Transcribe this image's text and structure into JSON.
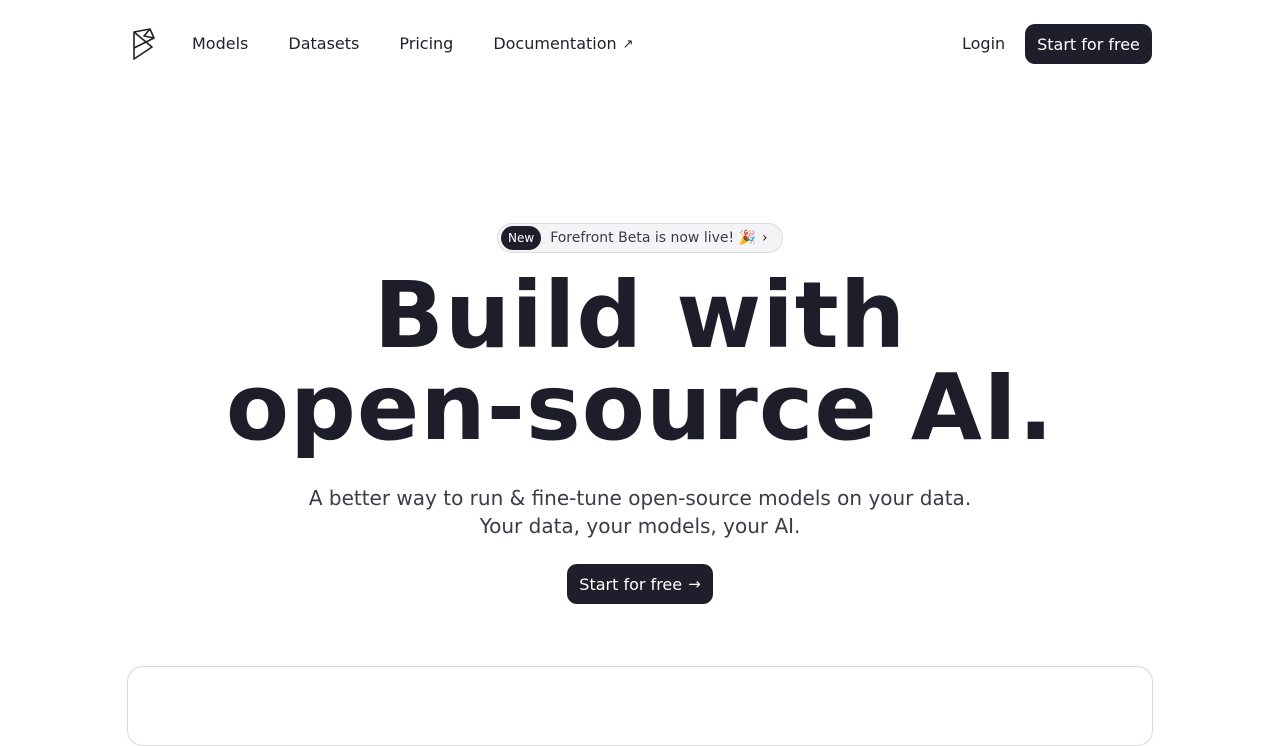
{
  "nav": {
    "logo_icon": "forefront-logo-icon",
    "links": [
      {
        "label": "Models"
      },
      {
        "label": "Datasets"
      },
      {
        "label": "Pricing"
      },
      {
        "label": "Documentation",
        "icon": "external-arrow-icon",
        "icon_glyph": "↗"
      }
    ],
    "login_label": "Login",
    "cta_label": "Start for free"
  },
  "announcement": {
    "badge": "New",
    "text": "Forefront Beta is now live! 🎉",
    "icon": "chevron-right-icon",
    "icon_glyph": "›"
  },
  "hero": {
    "title_line1": "Build with",
    "title_line2": "open-source AI.",
    "subtitle_line1": "A better way to run & fine-tune open-source models on your data.",
    "subtitle_line2": "Your data, your models, your AI.",
    "cta_label": "Start for free",
    "cta_icon": "arrow-right-icon",
    "cta_icon_glyph": "→"
  },
  "colors": {
    "primary": "#1f1f2b",
    "text_muted": "#3b3b4a",
    "badge_bg": "#f4f4f7"
  }
}
